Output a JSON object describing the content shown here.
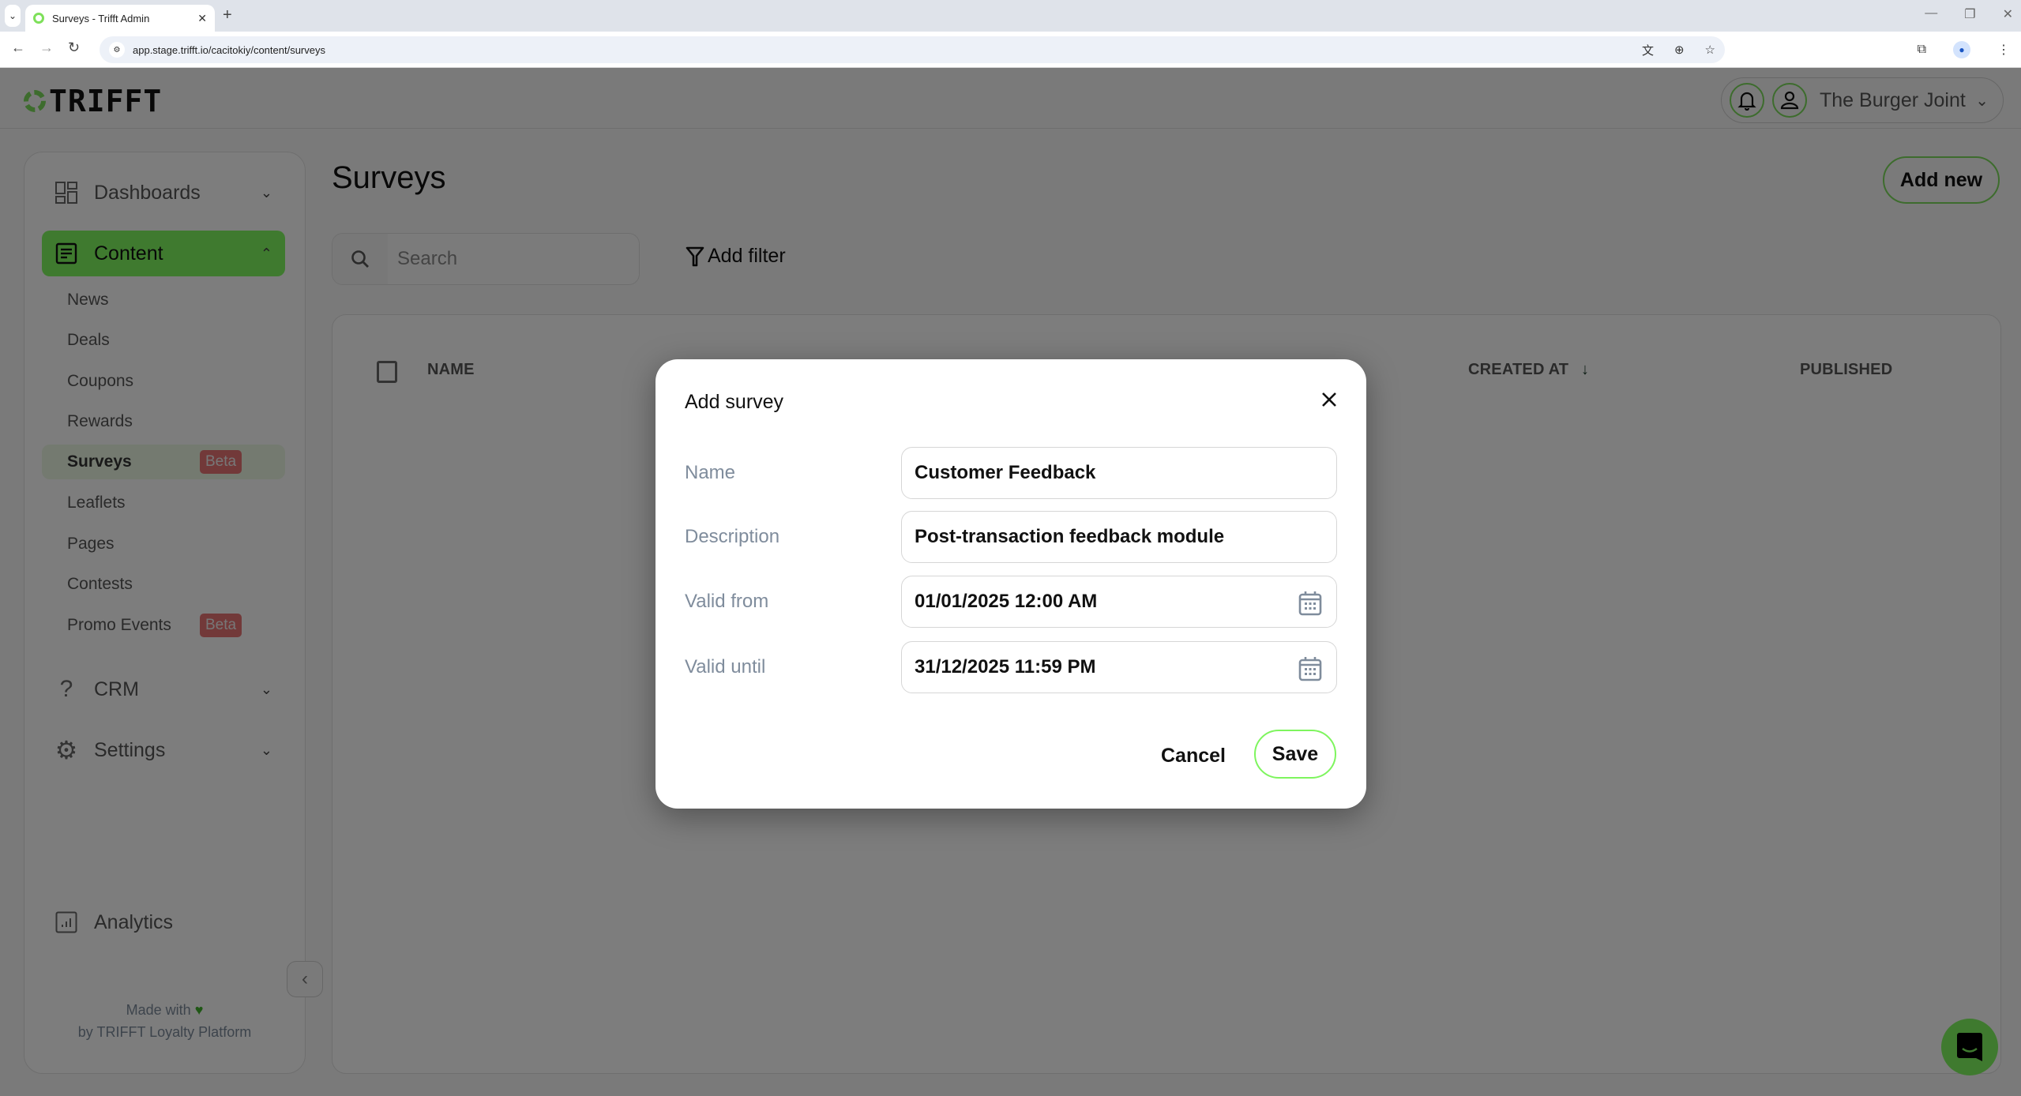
{
  "browser": {
    "tab_title": "Surveys - Trifft Admin",
    "new_tab": "+",
    "tab_close": "✕",
    "url": "app.stage.trifft.io/cacitokiy/content/surveys"
  },
  "header": {
    "logo_text": "TRIFFT",
    "org_name": "The Burger Joint"
  },
  "sidebar": {
    "groups": [
      {
        "label": "Dashboards",
        "icon": "dashboard-icon",
        "expanded": false
      },
      {
        "label": "Content",
        "icon": "document-icon",
        "expanded": true,
        "active": true
      },
      {
        "label": "CRM",
        "icon": "question-icon",
        "expanded": false
      },
      {
        "label": "Settings",
        "icon": "gear-icon",
        "expanded": false
      },
      {
        "label": "Analytics",
        "icon": "analytics-icon"
      }
    ],
    "content_items": [
      {
        "label": "News"
      },
      {
        "label": "Deals"
      },
      {
        "label": "Coupons"
      },
      {
        "label": "Rewards"
      },
      {
        "label": "Surveys",
        "badge": "Beta",
        "active": true
      },
      {
        "label": "Leaflets"
      },
      {
        "label": "Pages"
      },
      {
        "label": "Contests"
      },
      {
        "label": "Promo Events",
        "badge": "Beta"
      }
    ],
    "footer_line1": "Made with",
    "footer_line2": "by TRIFFT Loyalty Platform"
  },
  "main": {
    "title": "Surveys",
    "add_new_label": "Add new",
    "search_placeholder": "Search",
    "add_filter_label": "Add filter",
    "columns": [
      "NAME",
      "CREATED AT",
      "PUBLISHED"
    ]
  },
  "modal": {
    "title": "Add survey",
    "fields": [
      {
        "label": "Name",
        "value": "Customer Feedback"
      },
      {
        "label": "Description",
        "value": "Post-transaction feedback module"
      },
      {
        "label": "Valid from",
        "value": "01/01/2025 12:00 AM"
      },
      {
        "label": "Valid until",
        "value": "31/12/2025 11:59 PM"
      }
    ],
    "cancel_label": "Cancel",
    "save_label": "Save"
  },
  "colors": {
    "accent": "#7ef55e",
    "badge": "#e57373",
    "overlay": "rgba(0,0,0,0.5)"
  }
}
